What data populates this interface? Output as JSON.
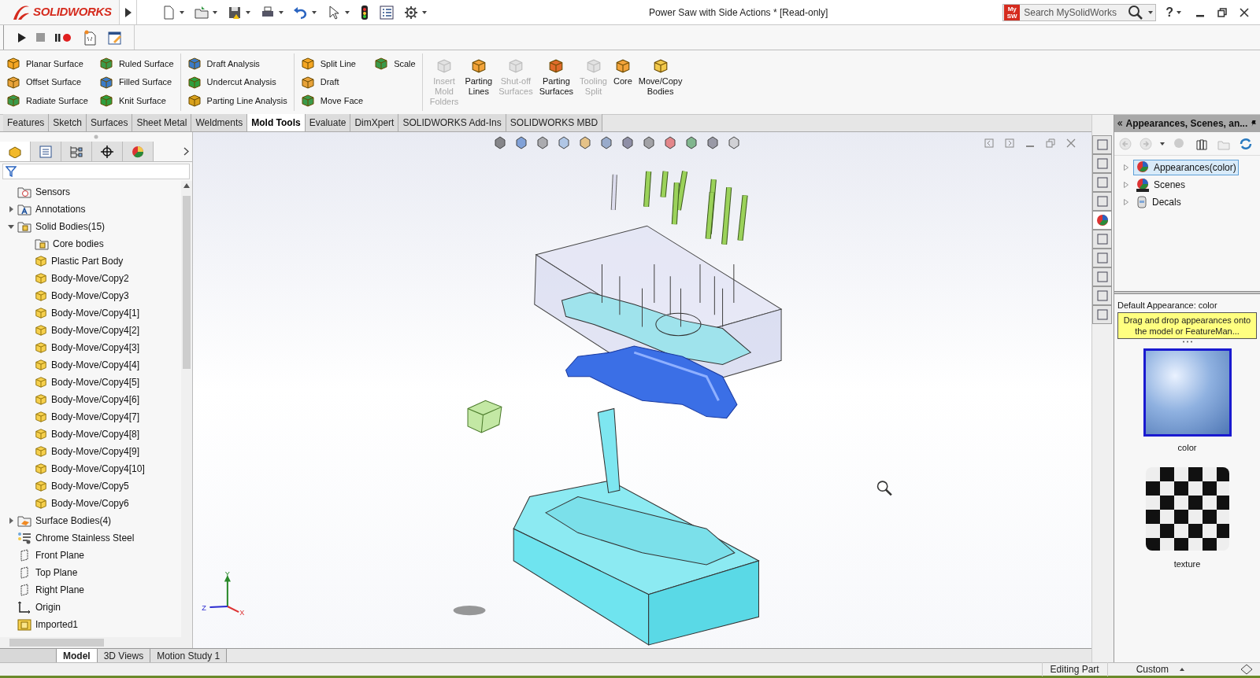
{
  "title_bar": {
    "brand": "SOLIDWORKS",
    "title": "Power Saw with Side Actions * [Read-only]",
    "search_badge": [
      "My",
      "SW"
    ],
    "search_placeholder": "Search MySolidWorks",
    "help_glyph": "?"
  },
  "command_manager": {
    "groups": [
      {
        "kind": "small",
        "columns": [
          [
            "Planar Surface",
            "Offset Surface",
            "Radiate Surface"
          ],
          [
            "Ruled Surface",
            "Filled Surface",
            "Knit Surface"
          ]
        ]
      },
      {
        "kind": "small",
        "columns": [
          [
            "Draft Analysis",
            "Undercut Analysis",
            "Parting Line Analysis"
          ]
        ]
      },
      {
        "kind": "small",
        "columns": [
          [
            "Split Line",
            "Draft",
            "Move Face"
          ],
          [
            "Scale"
          ]
        ]
      },
      {
        "kind": "large",
        "items": [
          {
            "lines": [
              "Insert",
              "Mold",
              "Folders"
            ],
            "disabled": true
          },
          {
            "lines": [
              "Parting",
              "Lines"
            ],
            "disabled": false
          },
          {
            "lines": [
              "Shut-off",
              "Surfaces"
            ],
            "disabled": true
          },
          {
            "lines": [
              "Parting",
              "Surfaces"
            ],
            "disabled": false
          },
          {
            "lines": [
              "Tooling",
              "Split"
            ],
            "disabled": true
          },
          {
            "lines": [
              "Core"
            ],
            "disabled": false
          },
          {
            "lines": [
              "Move/Copy",
              "Bodies"
            ],
            "disabled": false
          }
        ]
      }
    ]
  },
  "tabs": [
    {
      "label": "Features",
      "selected": false
    },
    {
      "label": "Sketch",
      "selected": false
    },
    {
      "label": "Surfaces",
      "selected": false
    },
    {
      "label": "Sheet Metal",
      "selected": false
    },
    {
      "label": "Weldments",
      "selected": false
    },
    {
      "label": "Mold Tools",
      "selected": true
    },
    {
      "label": "Evaluate",
      "selected": false
    },
    {
      "label": "DimXpert",
      "selected": false
    },
    {
      "label": "SOLIDWORKS Add-Ins",
      "selected": false
    },
    {
      "label": "SOLIDWORKS MBD",
      "selected": false
    }
  ],
  "panel_tabs": [
    {
      "selected": true
    },
    {
      "selected": false
    },
    {
      "selected": false
    },
    {
      "selected": false
    },
    {
      "selected": false
    }
  ],
  "feature_tree": [
    {
      "label": "Sensors",
      "kind": "sensor"
    },
    {
      "label": "Annotations",
      "kind": "annotation",
      "expanded": false
    },
    {
      "label": "Solid Bodies(15)",
      "kind": "folder",
      "expanded": true,
      "children": [
        {
          "label": "Core bodies",
          "kind": "folder"
        },
        {
          "label": "Plastic Part Body",
          "kind": "body"
        },
        {
          "label": "Body-Move/Copy2",
          "kind": "body"
        },
        {
          "label": "Body-Move/Copy3",
          "kind": "body"
        },
        {
          "label": "Body-Move/Copy4[1]",
          "kind": "body"
        },
        {
          "label": "Body-Move/Copy4[2]",
          "kind": "body"
        },
        {
          "label": "Body-Move/Copy4[3]",
          "kind": "body"
        },
        {
          "label": "Body-Move/Copy4[4]",
          "kind": "body"
        },
        {
          "label": "Body-Move/Copy4[5]",
          "kind": "body"
        },
        {
          "label": "Body-Move/Copy4[6]",
          "kind": "body"
        },
        {
          "label": "Body-Move/Copy4[7]",
          "kind": "body"
        },
        {
          "label": "Body-Move/Copy4[8]",
          "kind": "body"
        },
        {
          "label": "Body-Move/Copy4[9]",
          "kind": "body"
        },
        {
          "label": "Body-Move/Copy4[10]",
          "kind": "body"
        },
        {
          "label": "Body-Move/Copy5",
          "kind": "body"
        },
        {
          "label": "Body-Move/Copy6",
          "kind": "body"
        }
      ]
    },
    {
      "label": "Surface Bodies(4)",
      "kind": "surface",
      "expanded": false
    },
    {
      "label": "Chrome Stainless Steel",
      "kind": "material"
    },
    {
      "label": "Front Plane",
      "kind": "plane"
    },
    {
      "label": "Top Plane",
      "kind": "plane"
    },
    {
      "label": "Right Plane",
      "kind": "plane"
    },
    {
      "label": "Origin",
      "kind": "origin"
    },
    {
      "label": "Imported1",
      "kind": "imported"
    }
  ],
  "triad": {
    "y": "Y",
    "z": "Z",
    "x": "X"
  },
  "model_tabs": [
    {
      "label": "Model",
      "selected": true
    },
    {
      "label": "3D Views",
      "selected": false
    },
    {
      "label": "Motion Study 1",
      "selected": false
    }
  ],
  "task_pane": {
    "title": "Appearances, Scenes, an...",
    "tree": [
      {
        "label": "Appearances(color)",
        "kind": "appearance",
        "selected": true
      },
      {
        "label": "Scenes",
        "kind": "scene",
        "selected": false
      },
      {
        "label": "Decals",
        "kind": "decal",
        "selected": false
      }
    ],
    "default_label": "Default Appearance: color",
    "tooltip": "Drag and drop appearances onto the model or FeatureMan...",
    "swatches": [
      {
        "label": "color",
        "kind": "glossy",
        "selected": true
      },
      {
        "label": "texture",
        "kind": "checker",
        "selected": false
      }
    ]
  },
  "status_bar": {
    "mode": "Editing Part",
    "units": "Custom"
  }
}
